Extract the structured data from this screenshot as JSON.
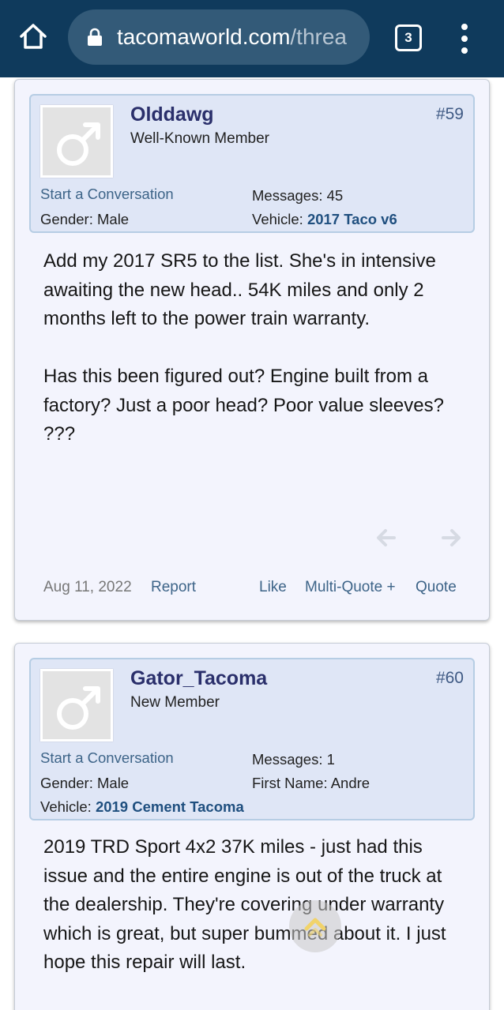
{
  "browser": {
    "url_domain": "tacomaworld.com",
    "url_path": "/threa",
    "tab_count": "3",
    "icons": [
      "home-icon",
      "lock-icon",
      "menu-dots-icon"
    ]
  },
  "posts": [
    {
      "username": "Olddawg",
      "user_title": "Well-Known Member",
      "post_number": "#59",
      "start_conversation": "Start a Conversation",
      "gender_label": "Gender:",
      "gender_value": "Male",
      "messages_label": "Messages:",
      "messages_value": "45",
      "vehicle_label": "Vehicle:",
      "vehicle_value": "2017 Taco v6",
      "body": [
        "Add my 2017 SR5 to the list. She's in intensive awaiting the new head.. 54K miles and only 2 months left to the power train warranty.",
        "Has this been figured out? Engine built from a factory? Just a poor head? Poor value sleeves? ???"
      ],
      "date": "Aug 11, 2022",
      "report": "Report",
      "like": "Like",
      "multi_quote": "Multi-Quote +",
      "quote": "Quote"
    },
    {
      "username": "Gator_Tacoma",
      "user_title": "New Member",
      "post_number": "#60",
      "start_conversation": "Start a Conversation",
      "gender_label": "Gender:",
      "gender_value": "Male",
      "messages_label": "Messages:",
      "messages_value": "1",
      "first_name_label": "First Name:",
      "first_name_value": "Andre",
      "vehicle_label": "Vehicle:",
      "vehicle_value": "2019 Cement Tacoma",
      "body": [
        "2019 TRD Sport 4x2 37K miles - just had this issue and the entire engine is out of the truck at the dealership. They're covering under warranty which is great, but super bummed about it. I just hope this repair will last."
      ]
    }
  ],
  "colors": {
    "browser_bar": "#0f3a5c",
    "post_bg": "#f3f4fd",
    "userinfo_bg": "#dfe6f6",
    "link": "#3d6488",
    "username": "#2a2f6b"
  }
}
